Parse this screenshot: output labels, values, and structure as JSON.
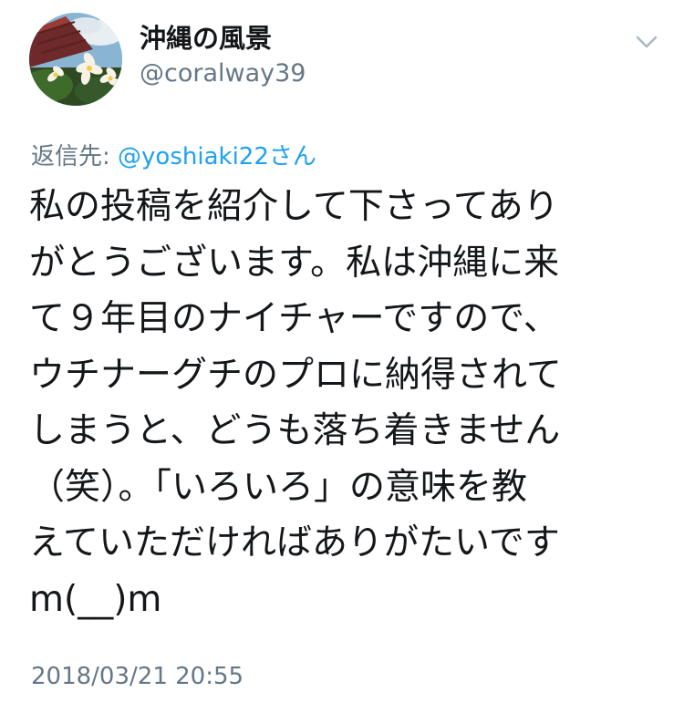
{
  "tweet": {
    "author": {
      "display_name": "沖縄の風景",
      "handle": "@coralway39"
    },
    "reply_to": {
      "prefix": "返信先: ",
      "mention": "@yoshiaki22さん"
    },
    "text_lines": [
      "私の投稿を紹介して下さってあり",
      "がとうございます。私は沖縄に来",
      "て９年目のナイチャーですので、",
      "ウチナーグチのプロに納得されて",
      "しまうと、どうも落ち着きません",
      "（笑）。「いろいろ」の意味を教",
      "えていただければありがたいです",
      "m(__)m"
    ],
    "timestamp": "2018/03/21 20:55"
  },
  "icons": {
    "menu": "chevron-down-icon"
  },
  "colors": {
    "text": "#14171a",
    "secondary": "#657786",
    "link": "#1da1f2"
  }
}
